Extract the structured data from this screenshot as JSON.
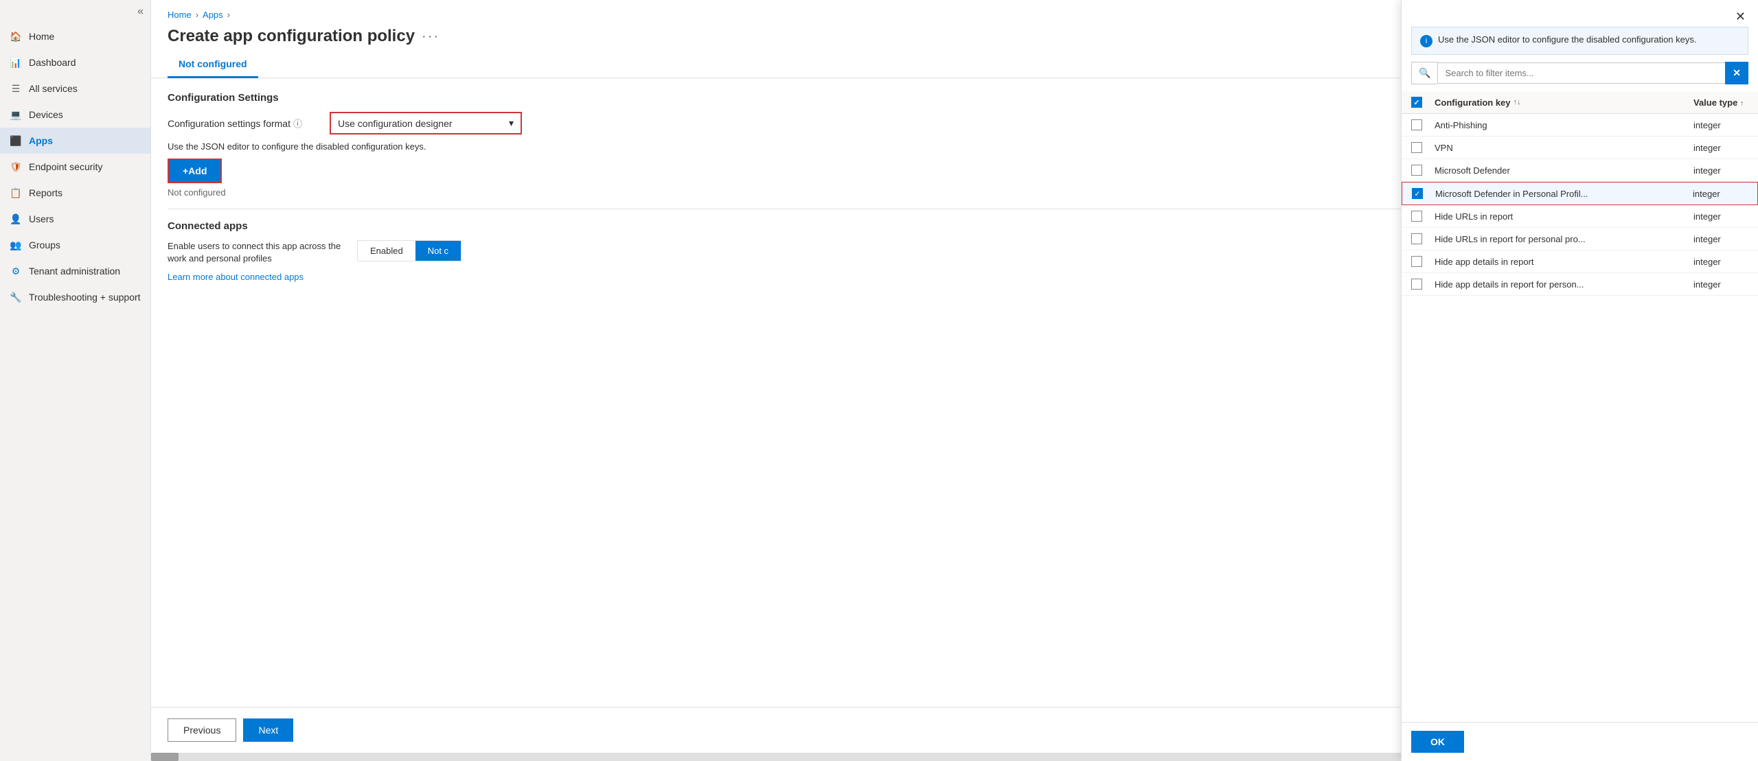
{
  "sidebar": {
    "collapse_icon": "«",
    "items": [
      {
        "id": "home",
        "label": "Home",
        "icon": "🏠",
        "iconClass": "icon-home",
        "active": false
      },
      {
        "id": "dashboard",
        "label": "Dashboard",
        "icon": "📊",
        "iconClass": "icon-dashboard",
        "active": false
      },
      {
        "id": "all-services",
        "label": "All services",
        "icon": "☰",
        "iconClass": "icon-services",
        "active": false
      },
      {
        "id": "devices",
        "label": "Devices",
        "icon": "💻",
        "iconClass": "icon-devices",
        "active": false
      },
      {
        "id": "apps",
        "label": "Apps",
        "icon": "⬛",
        "iconClass": "icon-apps",
        "active": true
      },
      {
        "id": "endpoint-security",
        "label": "Endpoint security",
        "icon": "🛡",
        "iconClass": "icon-endpoint",
        "active": false
      },
      {
        "id": "reports",
        "label": "Reports",
        "icon": "📋",
        "iconClass": "icon-reports",
        "active": false
      },
      {
        "id": "users",
        "label": "Users",
        "icon": "👤",
        "iconClass": "icon-users",
        "active": false
      },
      {
        "id": "groups",
        "label": "Groups",
        "icon": "👥",
        "iconClass": "icon-groups",
        "active": false
      },
      {
        "id": "tenant-administration",
        "label": "Tenant administration",
        "icon": "⚙",
        "iconClass": "icon-tenant",
        "active": false
      },
      {
        "id": "troubleshooting",
        "label": "Troubleshooting + support",
        "icon": "🔧",
        "iconClass": "icon-trouble",
        "active": false
      }
    ]
  },
  "breadcrumb": {
    "items": [
      {
        "label": "Home",
        "href": "#"
      },
      {
        "label": "Apps",
        "href": "#"
      }
    ]
  },
  "page": {
    "title": "Create app configuration policy",
    "dots_label": "···",
    "tab_label": "Not configured"
  },
  "config_settings": {
    "section_title": "Configuration Settings",
    "field_label": "Configuration settings format",
    "dropdown_value": "Use configuration designer",
    "json_note": "Use the JSON editor to configure the disabled configuration keys.",
    "add_button_label": "+Add",
    "not_configured_label": "Not configured"
  },
  "connected_apps": {
    "section_title": "Connected apps",
    "field_label": "Enable users to connect this app across\nthe work and personal profiles",
    "toggle_enabled": "Enabled",
    "toggle_not_configured": "Not c",
    "learn_more_label": "Learn more about connected apps"
  },
  "footer": {
    "previous_label": "Previous",
    "next_label": "Next"
  },
  "panel": {
    "close_icon": "✕",
    "info_text": "Use the JSON editor to configure the disabled configuration keys.",
    "search_placeholder": "Search to filter items...",
    "clear_icon": "✕",
    "columns": {
      "config_key": "Configuration key",
      "value_type": "Value type"
    },
    "rows": [
      {
        "id": "anti-phishing",
        "label": "Anti-Phishing",
        "value_type": "integer",
        "checked": false,
        "selected": false
      },
      {
        "id": "vpn",
        "label": "VPN",
        "value_type": "integer",
        "checked": false,
        "selected": false
      },
      {
        "id": "microsoft-defender",
        "label": "Microsoft Defender",
        "value_type": "integer",
        "checked": false,
        "selected": false
      },
      {
        "id": "microsoft-defender-personal",
        "label": "Microsoft Defender in Personal Profil...",
        "value_type": "integer",
        "checked": true,
        "selected": true
      },
      {
        "id": "hide-urls",
        "label": "Hide URLs in report",
        "value_type": "integer",
        "checked": false,
        "selected": false
      },
      {
        "id": "hide-urls-personal",
        "label": "Hide URLs in report for personal pro...",
        "value_type": "integer",
        "checked": false,
        "selected": false
      },
      {
        "id": "hide-app-details",
        "label": "Hide app details in report",
        "value_type": "integer",
        "checked": false,
        "selected": false
      },
      {
        "id": "hide-app-details-personal",
        "label": "Hide app details in report for person...",
        "value_type": "integer",
        "checked": false,
        "selected": false
      }
    ],
    "ok_button_label": "OK"
  }
}
